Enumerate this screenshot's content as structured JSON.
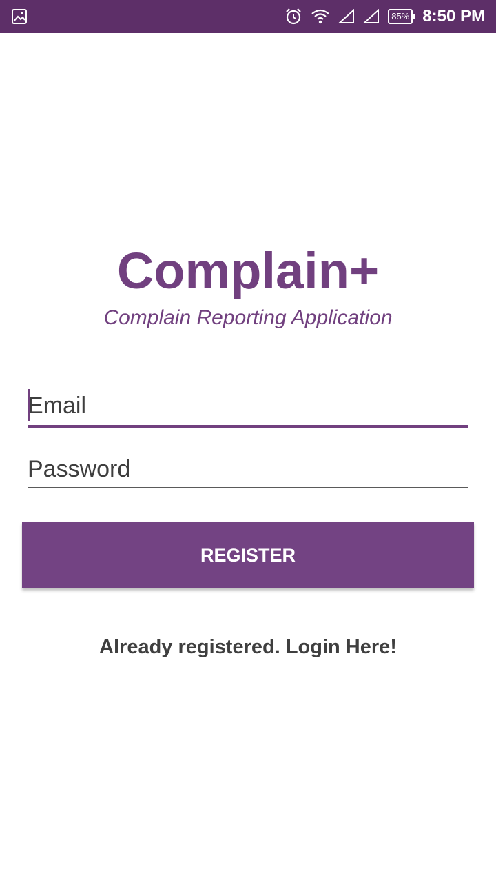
{
  "status_bar": {
    "notification_icon": "gallery-icon",
    "icons": [
      "alarm-icon",
      "wifi-icon",
      "signal-icon",
      "signal-icon"
    ],
    "battery": "85%",
    "time": "8:50 PM",
    "background": "#5d2f68"
  },
  "app": {
    "title": "Complain+",
    "subtitle": "Complain Reporting Application",
    "accent_color": "#71407f"
  },
  "form": {
    "email_placeholder": "Email",
    "password_placeholder": "Password",
    "register_label": "REGISTER",
    "login_link": "Already registered. Login Here!"
  }
}
